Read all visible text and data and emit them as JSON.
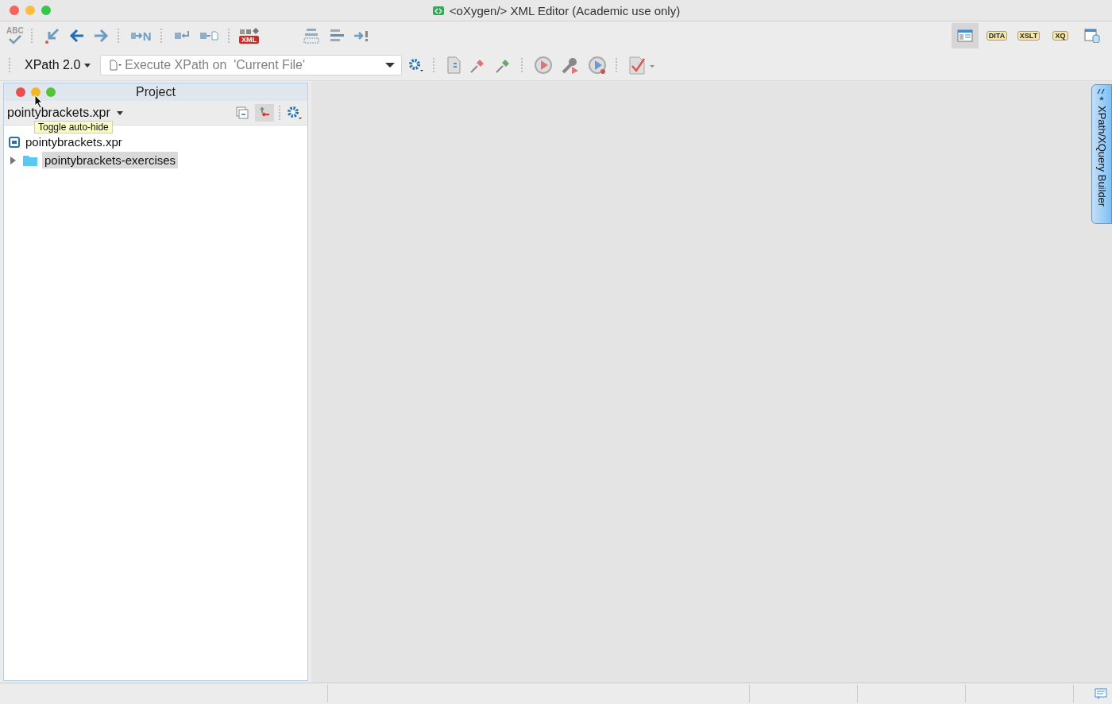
{
  "window": {
    "title": "<oXygen/> XML Editor (Academic use only)"
  },
  "toolbar": [
    {
      "kind": "spell",
      "label": "ABC"
    },
    {
      "kind": "sep"
    },
    {
      "kind": "import"
    },
    {
      "kind": "back"
    },
    {
      "kind": "forward"
    },
    {
      "kind": "sep"
    },
    {
      "kind": "format",
      "label": "N"
    },
    {
      "kind": "sep"
    },
    {
      "kind": "indent"
    },
    {
      "kind": "convert"
    },
    {
      "kind": "sep"
    },
    {
      "kind": "xml",
      "label": "XML"
    },
    {
      "kind": "gap"
    },
    {
      "kind": "list"
    },
    {
      "kind": "align"
    },
    {
      "kind": "goto"
    }
  ],
  "perspectives": [
    {
      "kind": "editor",
      "selected": true
    },
    {
      "kind": "badge",
      "label": "DITA",
      "selected": false
    },
    {
      "kind": "badge",
      "label": "XSLT",
      "selected": false
    },
    {
      "kind": "badge",
      "label": "XQ",
      "selected": false
    },
    {
      "kind": "db",
      "selected": false
    }
  ],
  "xpath_bar": {
    "version": "XPath 2.0",
    "placeholder": "Execute XPath on  'Current File'"
  },
  "xpath_tools": [
    {
      "kind": "sep"
    },
    {
      "kind": "doc"
    },
    {
      "kind": "pin"
    },
    {
      "kind": "pin2"
    },
    {
      "kind": "sep"
    },
    {
      "kind": "play"
    },
    {
      "kind": "wrench"
    },
    {
      "kind": "debug"
    },
    {
      "kind": "sep"
    },
    {
      "kind": "check"
    }
  ],
  "project_panel": {
    "title": "Project",
    "project": "pointybrackets.xpr",
    "tooltip": "Toggle auto-hide",
    "tree": [
      {
        "label": "pointybrackets.xpr",
        "kind": "project",
        "selected": false
      },
      {
        "label": "pointybrackets-exercises",
        "kind": "folder",
        "selected": true,
        "expanded": false
      }
    ]
  },
  "side_tab": {
    "label": "XPath/XQuery Builder"
  }
}
